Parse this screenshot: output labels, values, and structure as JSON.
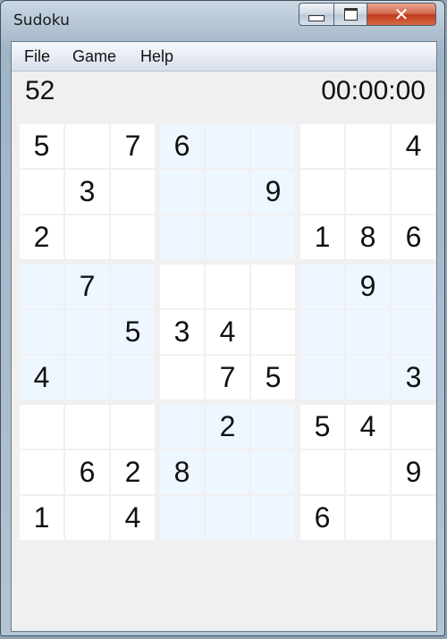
{
  "window": {
    "title": "Sudoku"
  },
  "menu": [
    "File",
    "Game",
    "Help"
  ],
  "status": {
    "count": "52",
    "timer": "00:00:00"
  },
  "colors": {
    "box_light": "#ffffff",
    "box_tint": "#eef6ff",
    "close_red": "#c0391c"
  },
  "board": [
    [
      "5",
      "",
      "7",
      "6",
      "",
      "",
      "",
      "",
      "4"
    ],
    [
      "",
      "3",
      "",
      "",
      "",
      "9",
      "",
      "",
      ""
    ],
    [
      "2",
      "",
      "",
      "",
      "",
      "",
      "1",
      "8",
      "6"
    ],
    [
      "",
      "7",
      "",
      "",
      "",
      "",
      "",
      "9",
      ""
    ],
    [
      "",
      "",
      "5",
      "3",
      "4",
      "",
      "",
      "",
      ""
    ],
    [
      "4",
      "",
      "",
      "",
      "7",
      "5",
      "",
      "",
      "3"
    ],
    [
      "",
      "",
      "",
      "",
      "2",
      "",
      "5",
      "4",
      ""
    ],
    [
      "",
      "6",
      "2",
      "8",
      "",
      "",
      "",
      "",
      "9"
    ],
    [
      "1",
      "",
      "4",
      "",
      "",
      "",
      "6",
      "",
      ""
    ]
  ]
}
